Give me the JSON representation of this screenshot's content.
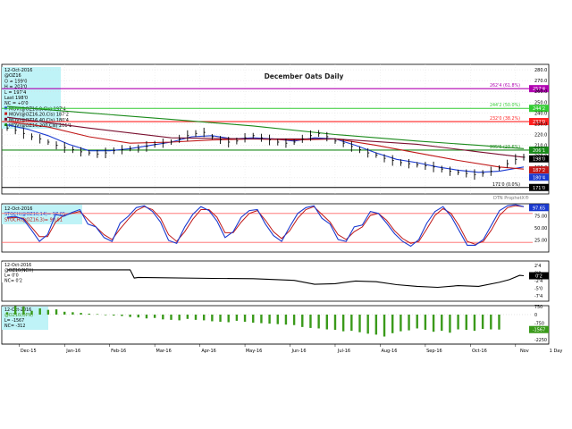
{
  "chart_data": {
    "type": "line",
    "title": "December Oats Daily",
    "source_tag": "DTN ProphetX®",
    "main": {
      "info_lines": [
        "12-Oct-2016",
        "@OZ16",
        "O = 199'0",
        "H = 203'0",
        "L = 197'4",
        "Last 198'0",
        "NC = +0'0"
      ],
      "legend_lines": [
        "MOV(@OZ16,9,Cls) 197'4",
        "MOV(@OZ16,20,Cls) 187'2",
        "MOV(@OZ16,40,Cls) 180'4",
        "MOV(@OZ16,200,Cls) 206'1"
      ],
      "ylim": [
        165,
        285
      ],
      "y_ticks": [
        180,
        190,
        200,
        210,
        220,
        230,
        240,
        250,
        260,
        270,
        280
      ],
      "y_tick_labels": [
        "180.0",
        "190.0",
        "200.0",
        "210.0",
        "220.0",
        "230.0",
        "240.0",
        "250.0",
        "260.0",
        "270.0",
        "280.0"
      ],
      "fib_levels": [
        {
          "label": "262'4 (61.8%)",
          "value": 262.5,
          "color": "#b000b0",
          "box": "257'4"
        },
        {
          "label": "244'2 (50.0%)",
          "value": 244.25,
          "color": "#33cc33",
          "box": "244'2"
        },
        {
          "label": "232'0 (38.2%)",
          "value": 232.0,
          "color": "#ff2020",
          "box": "232'0"
        },
        {
          "label": "205'5 (23.6%)",
          "value": 205.6,
          "color": "#1a8a1a",
          "box": "206'1"
        },
        {
          "label": "171'0 (0.0%)",
          "value": 171.0,
          "color": "#000000",
          "box": "171'0"
        }
      ],
      "right_boxes": [
        {
          "value": 197.5,
          "label": "198'0",
          "color": "#ffffff",
          "bg": "#000000"
        },
        {
          "value": 187.25,
          "label": "187'2",
          "color": "#ffffff",
          "bg": "#c01818"
        },
        {
          "value": 180.5,
          "label": "180'4",
          "color": "#ffffff",
          "bg": "#1a3ad0"
        }
      ],
      "close_series": [
        [
          0,
          226
        ],
        [
          4,
          224
        ],
        [
          8,
          221
        ],
        [
          12,
          218
        ],
        [
          16,
          216
        ],
        [
          20,
          213
        ],
        [
          24,
          210
        ],
        [
          28,
          208
        ],
        [
          32,
          206
        ],
        [
          36,
          204
        ],
        [
          40,
          203
        ],
        [
          44,
          202
        ],
        [
          48,
          203
        ],
        [
          52,
          205
        ],
        [
          56,
          206
        ],
        [
          60,
          207
        ],
        [
          64,
          207
        ],
        [
          68,
          209
        ],
        [
          72,
          211
        ],
        [
          76,
          212
        ],
        [
          80,
          213
        ],
        [
          84,
          216
        ],
        [
          88,
          219
        ],
        [
          92,
          221
        ],
        [
          96,
          222
        ],
        [
          100,
          218
        ],
        [
          104,
          215
        ],
        [
          108,
          213
        ],
        [
          112,
          214
        ],
        [
          116,
          217
        ],
        [
          120,
          219
        ],
        [
          124,
          217
        ],
        [
          128,
          215
        ],
        [
          132,
          213
        ],
        [
          136,
          212
        ],
        [
          140,
          213
        ],
        [
          144,
          216
        ],
        [
          148,
          219
        ],
        [
          152,
          221
        ],
        [
          156,
          218
        ],
        [
          160,
          214
        ],
        [
          164,
          212
        ],
        [
          168,
          209
        ],
        [
          172,
          206
        ],
        [
          176,
          203
        ],
        [
          180,
          201
        ],
        [
          184,
          198
        ],
        [
          188,
          196
        ],
        [
          192,
          194
        ],
        [
          196,
          193
        ],
        [
          200,
          192
        ],
        [
          204,
          191
        ],
        [
          208,
          190
        ],
        [
          212,
          188
        ],
        [
          216,
          186
        ],
        [
          220,
          185
        ],
        [
          224,
          184
        ],
        [
          228,
          183
        ],
        [
          232,
          184
        ],
        [
          236,
          186
        ],
        [
          240,
          189
        ],
        [
          244,
          193
        ],
        [
          248,
          197
        ],
        [
          252,
          199
        ]
      ],
      "ma_series": [
        {
          "name": "MOV(@OZ16,9,Cls)",
          "color": "#1a3ad0",
          "values": [
            [
              0,
              229
            ],
            [
              10,
              225
            ],
            [
              20,
              219
            ],
            [
              30,
              211
            ],
            [
              40,
              205
            ],
            [
              50,
              205
            ],
            [
              60,
              207
            ],
            [
              70,
              210
            ],
            [
              80,
              213
            ],
            [
              90,
              218
            ],
            [
              100,
              219
            ],
            [
              110,
              216
            ],
            [
              120,
              217
            ],
            [
              130,
              216
            ],
            [
              140,
              214
            ],
            [
              150,
              217
            ],
            [
              160,
              216
            ],
            [
              170,
              210
            ],
            [
              180,
              203
            ],
            [
              190,
              197
            ],
            [
              200,
              194
            ],
            [
              210,
              190
            ],
            [
              220,
              187
            ],
            [
              230,
              185
            ],
            [
              240,
              186
            ],
            [
              252,
              190
            ]
          ]
        },
        {
          "name": "MOV(@OZ16,20,Cls)",
          "color": "#c01818",
          "values": [
            [
              0,
              232
            ],
            [
              20,
              227
            ],
            [
              40,
              218
            ],
            [
              60,
              212
            ],
            [
              80,
              213
            ],
            [
              100,
              215
            ],
            [
              120,
              216
            ],
            [
              140,
              215
            ],
            [
              160,
              216
            ],
            [
              180,
              210
            ],
            [
              200,
              203
            ],
            [
              220,
              196
            ],
            [
              240,
              190
            ],
            [
              252,
              188
            ]
          ]
        },
        {
          "name": "MOV(@OZ16,40,Cls)",
          "color": "#7a1030",
          "values": [
            [
              0,
              236
            ],
            [
              40,
              226
            ],
            [
              80,
              217
            ],
            [
              120,
              216
            ],
            [
              160,
              216
            ],
            [
              200,
              211
            ],
            [
              230,
              204
            ],
            [
              252,
              199
            ]
          ]
        },
        {
          "name": "MOV(@OZ16,200,Cls)",
          "color": "#1a8a1a",
          "values": [
            [
              0,
              246
            ],
            [
              40,
              240
            ],
            [
              80,
              234
            ],
            [
              120,
              228
            ],
            [
              160,
              220
            ],
            [
              200,
              214
            ],
            [
              230,
              210
            ],
            [
              252,
              207
            ]
          ]
        }
      ]
    },
    "stoch": {
      "info_lines": [
        "12-Oct-2016",
        "STOCH(@OZ16,14)= 97.65",
        "STOCH(@OZ16,3)= 90.01"
      ],
      "ylim": [
        0,
        100
      ],
      "y_ticks": [
        25,
        50,
        75
      ],
      "y_tick_labels": [
        "25.00",
        "50.00",
        "75.00"
      ],
      "overbought": 80,
      "oversold": 20,
      "right_box": "97.65",
      "k_values": [
        72,
        74,
        68,
        46,
        22,
        36,
        78,
        74,
        82,
        88,
        58,
        52,
        30,
        22,
        60,
        74,
        92,
        96,
        84,
        62,
        24,
        18,
        52,
        78,
        94,
        86,
        64,
        30,
        42,
        72,
        86,
        88,
        58,
        34,
        22,
        52,
        80,
        92,
        96,
        70,
        58,
        26,
        22,
        52,
        56,
        84,
        80,
        60,
        38,
        22,
        12,
        26,
        60,
        84,
        94,
        74,
        44,
        14,
        14,
        26,
        56,
        86,
        96,
        98,
        94
      ],
      "d_values": [
        70,
        72,
        70,
        52,
        32,
        32,
        62,
        76,
        80,
        84,
        68,
        52,
        36,
        26,
        48,
        68,
        86,
        94,
        88,
        70,
        36,
        22,
        42,
        68,
        88,
        88,
        72,
        40,
        40,
        62,
        80,
        86,
        66,
        42,
        28,
        44,
        70,
        88,
        94,
        78,
        62,
        36,
        26,
        42,
        52,
        76,
        80,
        66,
        44,
        28,
        18,
        22,
        48,
        76,
        90,
        80,
        54,
        22,
        16,
        22,
        46,
        76,
        92,
        96,
        94
      ],
      "color_k": "#1a3ad0",
      "color_d": "#c01818"
    },
    "cot": {
      "info_lines": [
        "12-Oct-2016",
        "@OZ16(NCH)",
        "L= 0'0",
        "NC= 0'2"
      ],
      "y_tick_labels": [
        "2'4",
        "0'0",
        "-2'4",
        "-5'0",
        "-7'4"
      ],
      "right_box": "0'2",
      "values": [
        [
          0,
          2.0
        ],
        [
          60,
          2.0
        ],
        [
          62,
          -0.5
        ],
        [
          64,
          -0.3
        ],
        [
          100,
          -0.6
        ],
        [
          120,
          -0.7
        ],
        [
          140,
          -1.2
        ],
        [
          150,
          -2.4
        ],
        [
          160,
          -2.2
        ],
        [
          170,
          -1.4
        ],
        [
          180,
          -1.6
        ],
        [
          190,
          -2.5
        ],
        [
          200,
          -3.0
        ],
        [
          210,
          -3.3
        ],
        [
          220,
          -2.8
        ],
        [
          230,
          -3.0
        ],
        [
          240,
          -1.8
        ],
        [
          245,
          -1.0
        ],
        [
          250,
          0.3
        ],
        [
          252,
          0.2
        ]
      ],
      "color": "#000000"
    },
    "net": {
      "info_lines": [
        "12-Oct-2016",
        "@OZ16(OPN)",
        "L= -1567",
        "NC= -312"
      ],
      "y_tick_labels": [
        "750",
        "0",
        "-750",
        "-1500",
        "-2250"
      ],
      "right_box": "-1567",
      "bars": [
        [
          0,
          250
        ],
        [
          4,
          900
        ],
        [
          8,
          850
        ],
        [
          12,
          400
        ],
        [
          16,
          650
        ],
        [
          20,
          500
        ],
        [
          24,
          550
        ],
        [
          28,
          300
        ],
        [
          32,
          250
        ],
        [
          36,
          180
        ],
        [
          40,
          100
        ],
        [
          44,
          50
        ],
        [
          48,
          -50
        ],
        [
          52,
          -100
        ],
        [
          56,
          -150
        ],
        [
          60,
          -250
        ],
        [
          64,
          -300
        ],
        [
          68,
          -400
        ],
        [
          72,
          -350
        ],
        [
          76,
          -500
        ],
        [
          80,
          -550
        ],
        [
          84,
          -600
        ],
        [
          88,
          -450
        ],
        [
          92,
          -550
        ],
        [
          96,
          -600
        ],
        [
          100,
          -700
        ],
        [
          104,
          -750
        ],
        [
          108,
          -800
        ],
        [
          112,
          -650
        ],
        [
          116,
          -750
        ],
        [
          120,
          -850
        ],
        [
          124,
          -900
        ],
        [
          128,
          -950
        ],
        [
          132,
          -1000
        ],
        [
          136,
          -1050
        ],
        [
          140,
          -1100
        ],
        [
          144,
          -1300
        ],
        [
          148,
          -1400
        ],
        [
          152,
          -1450
        ],
        [
          156,
          -1550
        ],
        [
          160,
          -1600
        ],
        [
          164,
          -1750
        ],
        [
          168,
          -1700
        ],
        [
          172,
          -1850
        ],
        [
          176,
          -2000
        ],
        [
          180,
          -2100
        ],
        [
          184,
          -2300
        ],
        [
          188,
          -1950
        ],
        [
          192,
          -1750
        ],
        [
          196,
          -1650
        ],
        [
          200,
          -1450
        ],
        [
          204,
          -1600
        ],
        [
          208,
          -1800
        ],
        [
          212,
          -1700
        ],
        [
          216,
          -1900
        ],
        [
          220,
          -1550
        ],
        [
          224,
          -1600
        ],
        [
          228,
          -1700
        ],
        [
          232,
          -1500
        ],
        [
          236,
          -1550
        ],
        [
          240,
          -1567
        ]
      ],
      "color": "#3a9a1a"
    },
    "x_axis": {
      "labels": [
        "Dec-15",
        "Jan-16",
        "Feb-16",
        "Mar-16",
        "Apr-16",
        "May-16",
        "Jun-16",
        "Jul-16",
        "Aug-16",
        "Sep-16",
        "Oct-16",
        "Nov"
      ],
      "label_pos": [
        6,
        28,
        50,
        72,
        94,
        116,
        138,
        160,
        182,
        204,
        226,
        248
      ],
      "extra": "1 Day"
    }
  }
}
